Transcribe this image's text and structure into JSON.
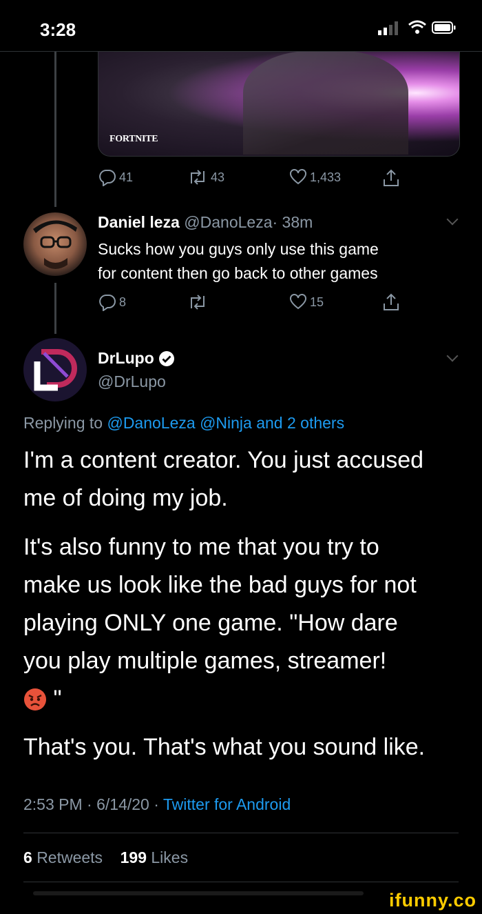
{
  "status_bar": {
    "time": "3:28"
  },
  "media": {
    "label": "FORTNITE"
  },
  "top_tweet_actions": {
    "replies": "41",
    "retweets": "43",
    "likes": "1,433"
  },
  "reply_tweet": {
    "name": "Daniel leza",
    "handle": "@DanoLeza",
    "age": "· 38m",
    "text_line1": "Sucks how you guys only use this game",
    "text_line2": "for content then go back to other games",
    "replies": "8",
    "likes": "15"
  },
  "main_tweet": {
    "name": "DrLupo",
    "handle": "@DrLupo",
    "replying_prefix": "Replying to",
    "replying_to": "@DanoLeza @Ninja and 2 others",
    "para1_line1": "I'm a content creator. You just accused",
    "para1_line2": "me of doing my job.",
    "para2_line1": "It's also funny to me that you try to",
    "para2_line2": "make us look like the bad guys for not",
    "para2_line3": "playing ONLY one game. \"How dare",
    "para2_line4": "you play multiple games, streamer!",
    "para2_tail": " \"",
    "para3": "That's you. That's what you sound like.",
    "timestamp": "2:53 PM · 6/14/20 ·",
    "source": "Twitter for Android",
    "retweets_count": "6",
    "retweets_label": "Retweets",
    "likes_count": "199",
    "likes_label": "Likes"
  },
  "watermark": "ifunny.co",
  "colors": {
    "link": "#1d9bf0",
    "muted": "#8b98a5",
    "background": "#000000",
    "watermark": "#ffcc00"
  }
}
